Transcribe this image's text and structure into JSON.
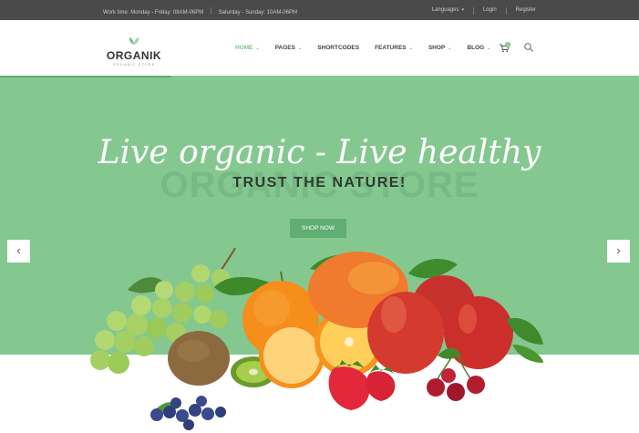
{
  "topbar": {
    "work_hours": "Work time: Monday - Friday: 08AM-06PM",
    "weekend_hours": "Saturday - Sunday: 10AM-06PM",
    "languages": "Languages",
    "login": "Login",
    "register": "Register"
  },
  "header": {
    "logo_name": "ORGANIK",
    "logo_tag": "ORGANIC STORE",
    "nav": [
      "HOME",
      "PAGES",
      "SHORTCODES",
      "FEATURES",
      "SHOP",
      "BLOG"
    ],
    "cart_count": "0"
  },
  "hero": {
    "script_line": "Live organic - Live healthy",
    "title": "TRUST THE NATURE!",
    "background_text": "ORGANIC STORE",
    "button": "SHOP NOW",
    "prev": "‹",
    "next": "›"
  },
  "colors": {
    "accent": "#7cc38d",
    "hero_bg": "#84c890",
    "topbar_bg": "#4a4a4a"
  },
  "icons": [
    "leaf-icon",
    "cart-icon",
    "search-icon",
    "chevron-left-icon",
    "chevron-right-icon"
  ]
}
